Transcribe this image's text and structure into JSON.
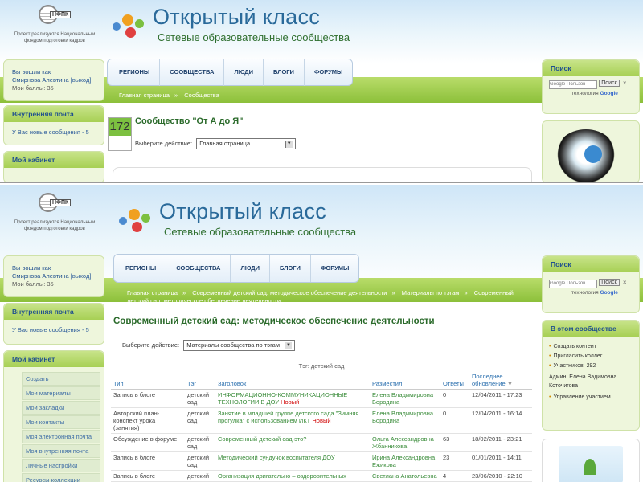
{
  "header": {
    "logo_mark": "НФПК",
    "logo_caption": "Проект реализуется Национальным фондом подготовки кадров",
    "title": "Открытый класс",
    "subtitle": "Сетевые образовательные сообщества"
  },
  "nav": [
    "РЕГИОНЫ",
    "СООБЩЕСТВА",
    "ЛЮДИ",
    "БЛОГИ",
    "ФОРУМЫ"
  ],
  "user": {
    "logged_in": "Вы вошли как",
    "name": "Смирнова Алевтина",
    "logout": "[выход]",
    "points": "Мои баллы: 35"
  },
  "mail": {
    "title": "Внутренняя почта",
    "text": "У Вас новые сообщения - 5"
  },
  "cabinet": {
    "title": "Мой кабинет",
    "items": [
      "Создать",
      "Мои материалы",
      "Мои закладки",
      "Мои контакты",
      "Моя электронная почта",
      "Моя внутренняя почта",
      "Личные настройки",
      "Ресурсы коллекции"
    ]
  },
  "search": {
    "title": "Поиск",
    "placeholder": "Google Пользов",
    "button": "Поиск",
    "close": "×",
    "tech_prefix": "технология",
    "tech_brand": "Google"
  },
  "community_box": {
    "title": "В этом сообществе",
    "items": [
      "Создать контент",
      "Пригласить коллег",
      "Участников: 292",
      "Админ: Елена Вадимовна Коточигова",
      "Управление участием"
    ]
  },
  "top": {
    "crumbs": [
      "Главная страница",
      "Сообщества"
    ],
    "count": "172",
    "title": "Сообщество \"От А до Я\"",
    "action_label": "Выберите действие:",
    "action_value": "Главная страница"
  },
  "bottom": {
    "crumbs": [
      "Главная страница",
      "Современный детский сад: методическое обеспечение деятельности",
      "Материалы по тэгам",
      "Современный детский сад: методическое обеспечение деятельности"
    ],
    "title": "Современный детский сад: методическое обеспечение деятельности",
    "action_label": "Выберите действие:",
    "action_value": "Материалы сообщества по тэгам",
    "tag_line": "Тэг: детский сад",
    "columns": [
      "Тип",
      "Тэг",
      "Заголовок",
      "Разместил",
      "Ответы",
      "Последнее обновление"
    ],
    "rows": [
      {
        "type": "Запись в блоге",
        "tag": "детский сад",
        "title": "ИНФОРМАЦИОННО-КОММУНИКАЦИОННЫЕ ТЕХНОЛОГИИ В ДОУ",
        "new": "Новый",
        "author": "Елена Владимировна Бородина",
        "replies": "0",
        "updated": "12/04/2011 - 17:23"
      },
      {
        "type": "Авторский план-конспект урока (занятия)",
        "tag": "детский сад",
        "title": "Занятие в младшей группе детского сада \"Зимняя прогулка\" с использованием ИКТ",
        "new": "Новый",
        "author": "Елена Владимировна Бородина",
        "replies": "0",
        "updated": "12/04/2011 - 16:14"
      },
      {
        "type": "Обсуждение в форуме",
        "tag": "детский сад",
        "title": "Современный детский сад-это?",
        "new": "",
        "author": "Ольга Александровна Жбанникова",
        "replies": "63",
        "updated": "18/02/2011 - 23:21"
      },
      {
        "type": "Запись в блоге",
        "tag": "детский сад",
        "title": "Методический сундучок воспитателя ДОУ",
        "new": "",
        "author": "Ирина Александровна Ежикова",
        "replies": "23",
        "updated": "01/01/2011 - 14:11"
      },
      {
        "type": "Запись в блоге",
        "tag": "детский",
        "title": "Организация двигательно – оздоровительных",
        "new": "",
        "author": "Светлана Анатольевна",
        "replies": "4",
        "updated": "23/06/2010 - 22:10"
      }
    ]
  },
  "colors": {
    "accent_green": "#8cc03a",
    "link_blue": "#2a6fae",
    "title_green": "#2a6a2a"
  }
}
